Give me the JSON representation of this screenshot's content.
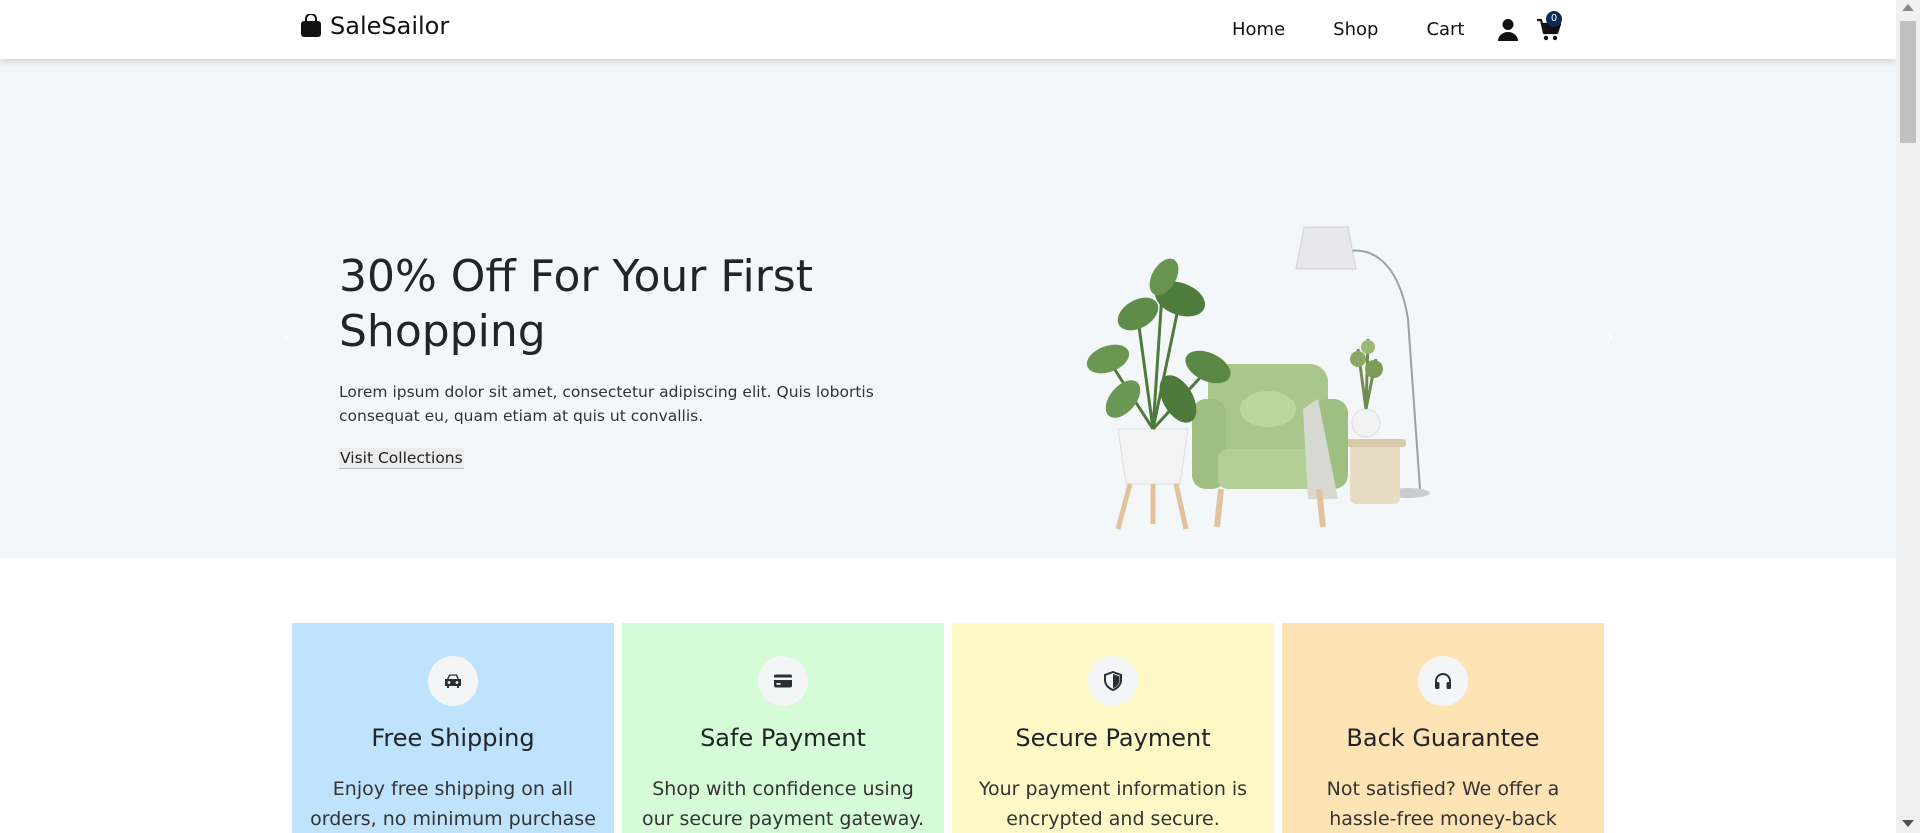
{
  "navbar": {
    "brand": "SaleSailor",
    "brand_icon": "shopping-bag-icon",
    "links": {
      "home": "Home",
      "shop": "Shop",
      "cart": "Cart"
    },
    "user_icon": "user-icon",
    "cart_icon": "cart-icon",
    "cart_count": "0"
  },
  "hero": {
    "title": "30% Off For Your First Shopping",
    "text": "Lorem ipsum dolor sit amet, consectetur adipiscing elit. Quis lobortis consequat eu, quam etiam at quis ut convallis.",
    "link": "Visit Collections",
    "prev_icon": "chevron-left-icon",
    "next_icon": "chevron-right-icon",
    "image": "green-armchair-with-plant-and-lamp"
  },
  "features": [
    {
      "title": "Free Shipping",
      "desc": "Enjoy free shipping on all orders, no minimum purchase required.",
      "icon": "car-icon",
      "color": "#bfe3fd"
    },
    {
      "title": "Safe Payment",
      "desc": "Shop with confidence using our secure payment gateway.",
      "icon": "credit-card-icon",
      "color": "#d5fcd6"
    },
    {
      "title": "Secure Payment",
      "desc": "Your payment information is encrypted and secure.",
      "icon": "shield-icon",
      "color": "#fef8c6"
    },
    {
      "title": "Back Guarantee",
      "desc": "Not satisfied? We offer a hassle-free money-back guarantee.",
      "icon": "headphones-icon",
      "color": "#fee3b4"
    }
  ]
}
